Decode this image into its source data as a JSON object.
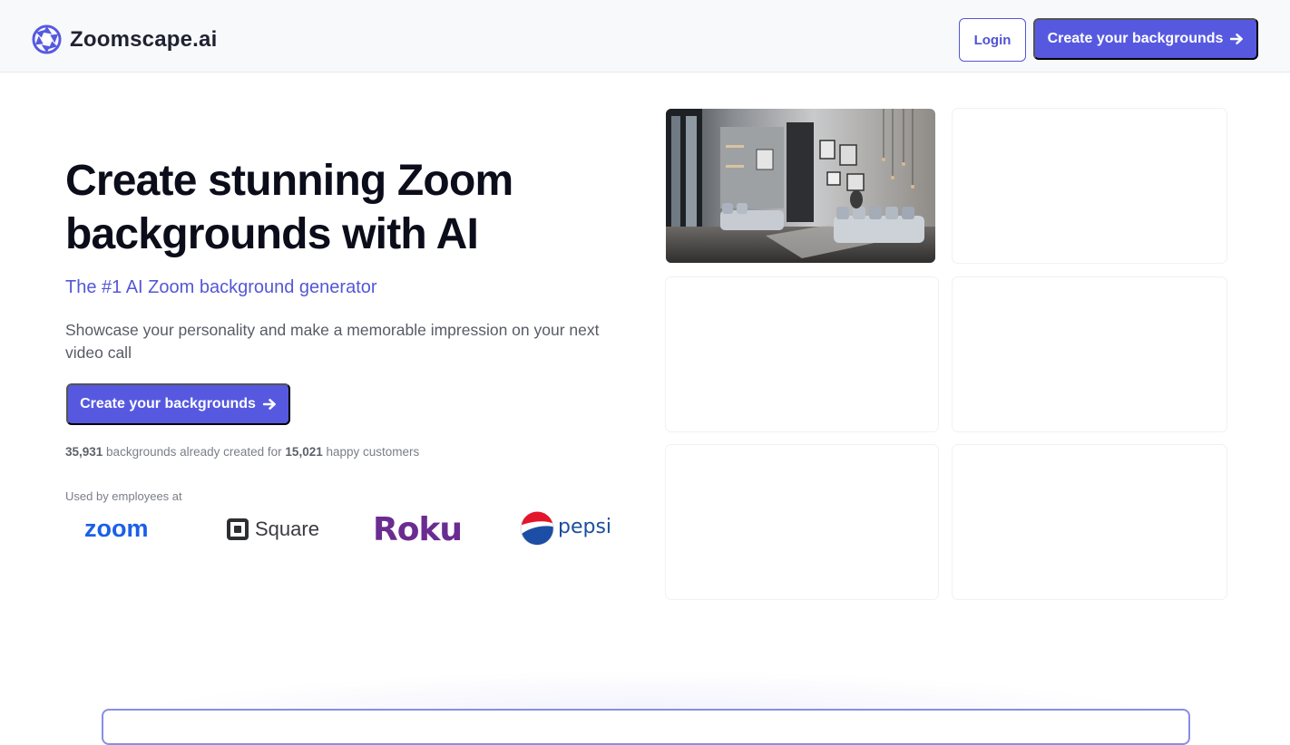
{
  "nav": {
    "brand_name": "Zoomscape.ai",
    "login_label": "Login",
    "cta_label": "Create your backgrounds"
  },
  "hero": {
    "title_line1": "Create stunning Zoom",
    "title_line2": "backgrounds with AI",
    "subtitle": "The #1 AI Zoom background generator",
    "description": "Showcase your personality and make a memorable impression on your next video call",
    "cta_label": "Create your backgrounds",
    "stats": {
      "backgrounds_count": "35,931",
      "backgrounds_text": " backgrounds already created for ",
      "customers_count": "15,021",
      "customers_text": " happy customers"
    },
    "used_by_label": "Used by employees at",
    "logos": {
      "zoom": "zoom",
      "square": "Square",
      "roku": "Roku",
      "pepsi": "pepsi"
    }
  },
  "gallery": {
    "tiles": [
      "living-room-background",
      "",
      "",
      "",
      "",
      ""
    ]
  },
  "colors": {
    "accent": "#5659e0",
    "accent_text": "#5457d6",
    "zoom_blue": "#1a5fe8",
    "roku_purple": "#6a2c91",
    "pepsi_blue": "#1b4f9c"
  },
  "icons": {
    "brand": "aperture-logo-icon",
    "arrow": "arrow-right-icon"
  }
}
